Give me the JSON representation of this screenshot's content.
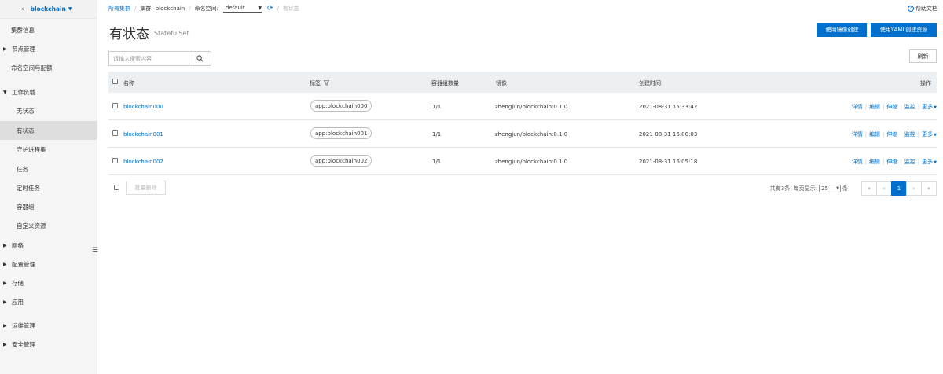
{
  "sidebar": {
    "cluster_name": "blockchain",
    "items": [
      {
        "label": "集群信息"
      },
      {
        "label": "节点管理"
      },
      {
        "label": "命名空间与配额"
      },
      {
        "label": "工作负载"
      },
      {
        "label": "无状态"
      },
      {
        "label": "有状态"
      },
      {
        "label": "守护进程集"
      },
      {
        "label": "任务"
      },
      {
        "label": "定时任务"
      },
      {
        "label": "容器组"
      },
      {
        "label": "自定义资源"
      },
      {
        "label": "网络"
      },
      {
        "label": "配置管理"
      },
      {
        "label": "存储"
      },
      {
        "label": "应用"
      },
      {
        "label": "运维管理"
      },
      {
        "label": "安全管理"
      }
    ]
  },
  "breadcrumb": {
    "all_clusters": "所有集群",
    "cluster_label": "集群:",
    "cluster_value": "blockchain",
    "namespace_label": "命名空间:",
    "namespace_value": "default",
    "current": "有状态"
  },
  "help_text": "帮助文档",
  "page": {
    "title": "有状态",
    "subtitle": "StatefulSet",
    "create_by_image": "使用镜像创建",
    "create_by_yaml": "使用YAML创建资源",
    "refresh": "刷新"
  },
  "search": {
    "placeholder": "请输入搜索内容"
  },
  "table": {
    "headers": {
      "name": "名称",
      "labels": "标签",
      "pods": "容器组数量",
      "image": "镜像",
      "created": "创建时间",
      "actions": "操作"
    },
    "rows": [
      {
        "name": "blockchain000",
        "label": "app:blockchain000",
        "pods": "1/1",
        "image": "zhengjun/blockchain:0.1.0",
        "created": "2021-08-31 15:33:42"
      },
      {
        "name": "blockchain001",
        "label": "app:blockchain001",
        "pods": "1/1",
        "image": "zhengjun/blockchain:0.1.0",
        "created": "2021-08-31 16:00:03"
      },
      {
        "name": "blockchain002",
        "label": "app:blockchain002",
        "pods": "1/1",
        "image": "zhengjun/blockchain:0.1.0",
        "created": "2021-08-31 16:05:18"
      }
    ],
    "actions": {
      "details": "详情",
      "edit": "编辑",
      "scale": "伸缩",
      "monitor": "监控",
      "more": "更多"
    }
  },
  "footer": {
    "batch_delete": "批量删除",
    "total_text": "共有3条, 每页显示:",
    "page_size": "25",
    "per_unit": "条",
    "current_page": "1",
    "first": "«",
    "prev": "‹",
    "next": "›",
    "last": "»"
  },
  "colors": {
    "accent": "#0070cc",
    "sidebar_bg": "#f5f5f5",
    "header_bg": "#edf0f2"
  }
}
